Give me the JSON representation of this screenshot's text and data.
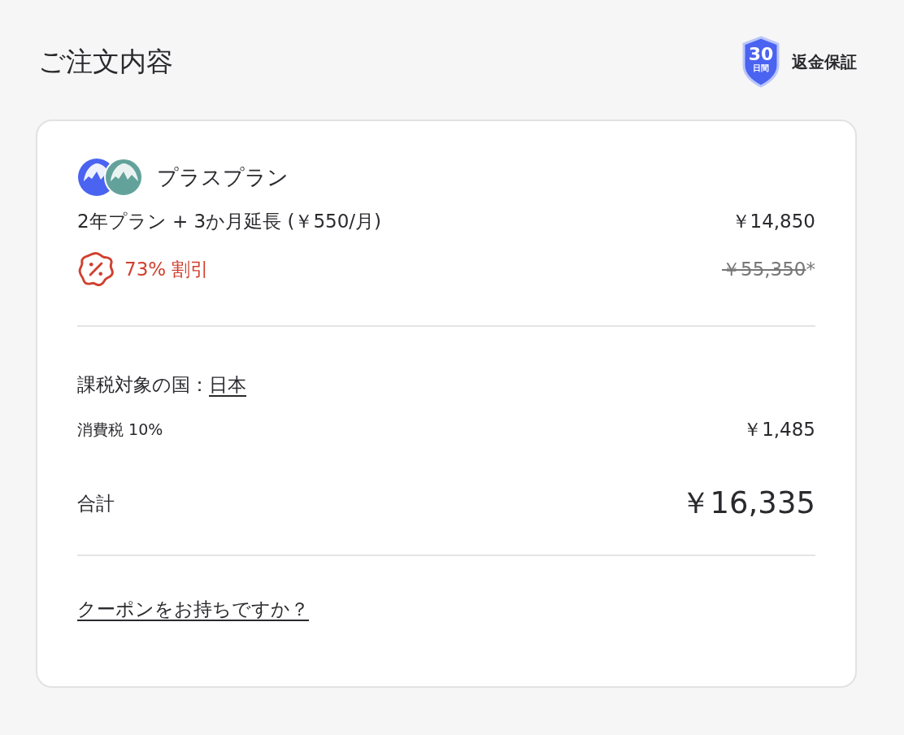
{
  "header": {
    "title": "ご注文内容",
    "guarantee_badge": {
      "days": "30",
      "unit": "日間"
    },
    "guarantee_label": "返金保証"
  },
  "plan": {
    "name": "プラスプラン",
    "term": "2年プラン + 3か月延長 (￥550/月)",
    "price": "￥14,850",
    "discount": "73% 割引",
    "original_price": "￥55,350",
    "original_price_note": "*"
  },
  "tax": {
    "country_label": "課税対象の国：",
    "country": "日本",
    "rate_label": "消費税 10%",
    "amount": "￥1,485"
  },
  "total": {
    "label": "合計",
    "amount": "￥16,335"
  },
  "coupon_link": "クーポンをお持ちですか？"
}
